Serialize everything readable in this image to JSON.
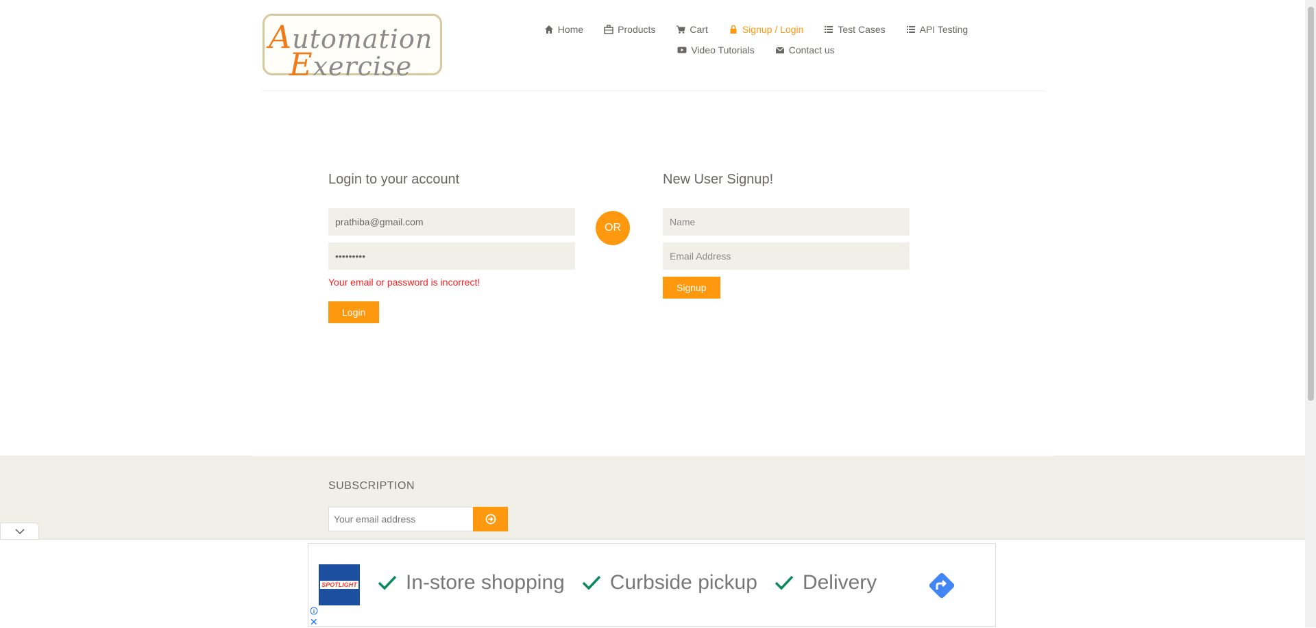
{
  "logo": {
    "line1_cap": "A",
    "line1_rest": "utomation",
    "line2_cap": "E",
    "line2_rest": "xercise"
  },
  "nav": {
    "row1": [
      {
        "label": "Home",
        "icon": "home-icon"
      },
      {
        "label": "Products",
        "icon": "products-icon"
      },
      {
        "label": "Cart",
        "icon": "cart-icon"
      },
      {
        "label": "Signup / Login",
        "icon": "lock-icon",
        "active": true
      },
      {
        "label": "Test Cases",
        "icon": "list-icon"
      },
      {
        "label": "API Testing",
        "icon": "list-icon"
      }
    ],
    "row2": [
      {
        "label": "Video Tutorials",
        "icon": "youtube-icon"
      },
      {
        "label": "Contact us",
        "icon": "envelope-icon"
      }
    ]
  },
  "login": {
    "title": "Login to your account",
    "email_value": "prathiba@gmail.com",
    "password_value": "•••••••••",
    "error": "Your email or password is incorrect!",
    "button": "Login"
  },
  "or_label": "OR",
  "signup": {
    "title": "New User Signup!",
    "name_placeholder": "Name",
    "email_placeholder": "Email Address",
    "button": "Signup"
  },
  "subscription": {
    "title": "SUBSCRIPTION",
    "placeholder": "Your email address"
  },
  "ad": {
    "brand": "SPOTLIGHT",
    "items": [
      "In-store shopping",
      "Curbside pickup",
      "Delivery"
    ]
  },
  "colors": {
    "accent": "#fe980f",
    "error": "#ff2020",
    "field_bg": "#f0f0e9"
  }
}
